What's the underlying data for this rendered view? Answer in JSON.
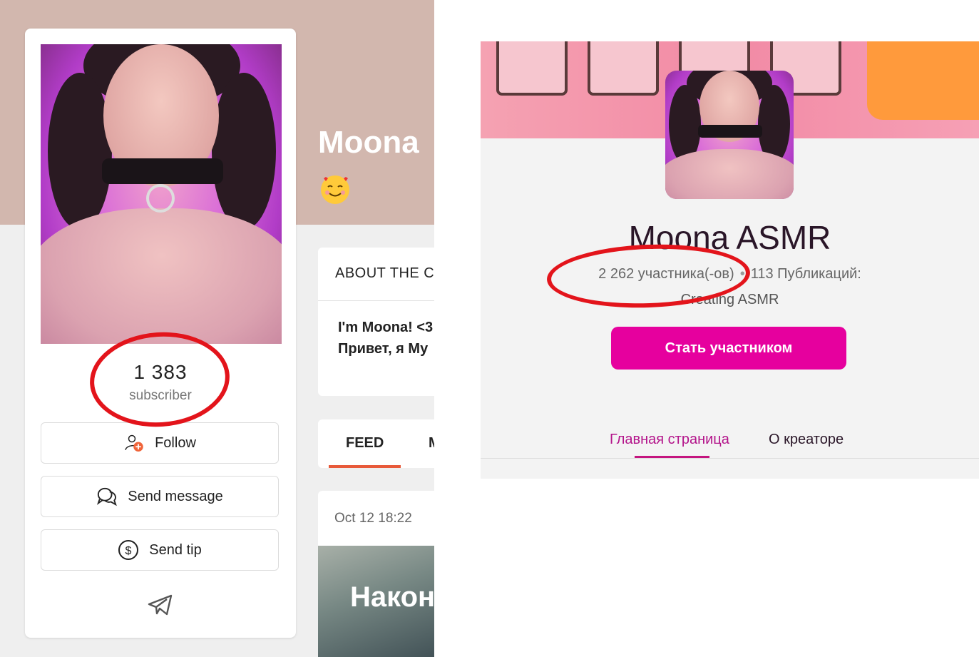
{
  "left_panel": {
    "creator_name": "Moona",
    "emoji": "🥰",
    "subscriber_count": "1 383",
    "subscriber_label": "subscriber",
    "buttons": {
      "follow": "Follow",
      "send_message": "Send message",
      "send_tip": "Send tip"
    },
    "about": {
      "title": "ABOUT THE C",
      "line1": "I'm Moona! <3",
      "line2": "Привет, я Му"
    },
    "tabs": [
      "FEED",
      "M"
    ],
    "post": {
      "date": "Oct 12 18:22",
      "text": "Након"
    },
    "colors": {
      "banner": "#d2b7ae",
      "follow_badge": "#f0643a",
      "feed_underline": "#e85a3a"
    }
  },
  "right_panel": {
    "creator_name": "Moona ASMR",
    "members": "2 262 участника(-ов)",
    "separator": "•",
    "publications": "113 Публикаций:",
    "tagline": "Creating ASMR",
    "join_button": "Стать участником",
    "tabs": {
      "main": "Главная страница",
      "about": "О креаторе"
    },
    "colors": {
      "join_button": "#e6009e",
      "active_tab": "#b3138a",
      "banner": "#f28aa5",
      "accent_block": "#ff9a3c"
    }
  },
  "annotations": {
    "color": "#e3141b",
    "shape": "hand-drawn ellipse"
  }
}
